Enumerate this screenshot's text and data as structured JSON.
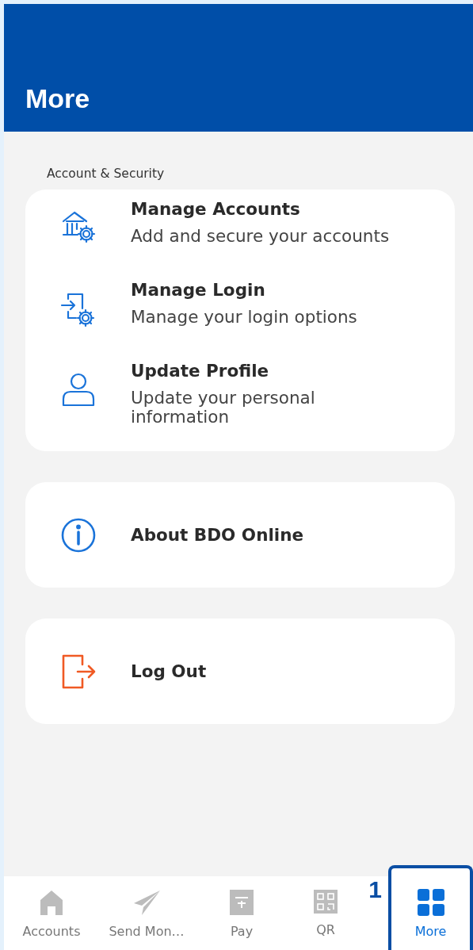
{
  "header": {
    "title": "More"
  },
  "section_label": "Account & Security",
  "security_items": [
    {
      "title": "Manage Accounts",
      "subtitle": "Add and secure your accounts"
    },
    {
      "title": "Manage Login",
      "subtitle": "Manage your login options"
    },
    {
      "title": "Update Profile",
      "subtitle": "Update your personal information"
    }
  ],
  "cards": [
    {
      "title": "About BDO Online",
      "kind": "info"
    },
    {
      "title": "Log Out",
      "kind": "logout"
    }
  ],
  "tabs": [
    {
      "label": "Accounts",
      "selected": false
    },
    {
      "label": "Send Mon…",
      "selected": false
    },
    {
      "label": "Pay",
      "selected": false
    },
    {
      "label": "QR",
      "selected": false
    },
    {
      "label": "More",
      "selected": true
    }
  ],
  "callout": {
    "number": "1"
  }
}
